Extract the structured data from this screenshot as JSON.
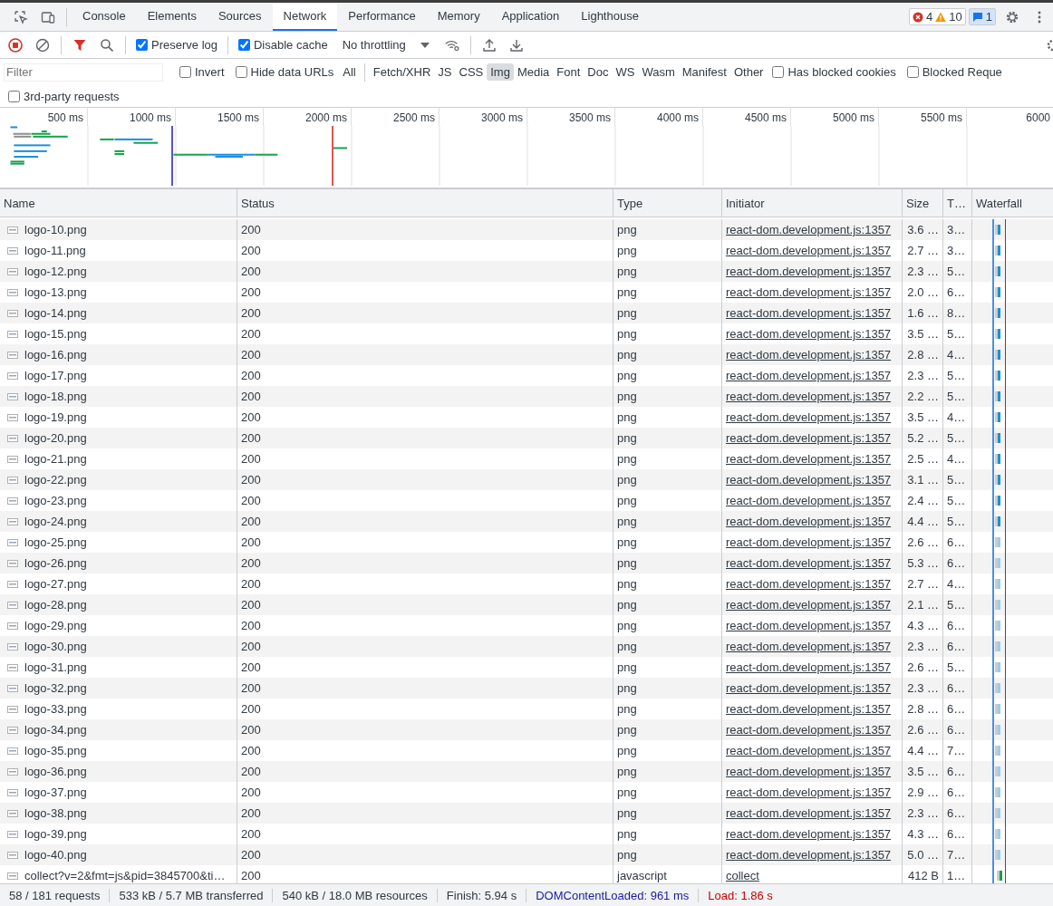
{
  "tabs": [
    {
      "label": "Console",
      "selected": false
    },
    {
      "label": "Elements",
      "selected": false
    },
    {
      "label": "Sources",
      "selected": false
    },
    {
      "label": "Network",
      "selected": true
    },
    {
      "label": "Performance",
      "selected": false
    },
    {
      "label": "Memory",
      "selected": false
    },
    {
      "label": "Application",
      "selected": false
    },
    {
      "label": "Lighthouse",
      "selected": false
    }
  ],
  "counters": {
    "errors": "4",
    "warnings": "10",
    "messages": "1"
  },
  "toolbar": {
    "preserve_log": {
      "label": "Preserve log",
      "checked": true
    },
    "disable_cache": {
      "label": "Disable cache",
      "checked": true
    },
    "throttling": "No throttling"
  },
  "filter": {
    "placeholder": "Filter",
    "options": [
      {
        "label": "Invert",
        "checked": false
      },
      {
        "label": "Hide data URLs",
        "checked": false
      }
    ],
    "types": [
      {
        "label": "All",
        "selected": false
      },
      {
        "label": "Fetch/XHR",
        "selected": false
      },
      {
        "label": "JS",
        "selected": false
      },
      {
        "label": "CSS",
        "selected": false
      },
      {
        "label": "Img",
        "selected": true
      },
      {
        "label": "Media",
        "selected": false
      },
      {
        "label": "Font",
        "selected": false
      },
      {
        "label": "Doc",
        "selected": false
      },
      {
        "label": "WS",
        "selected": false
      },
      {
        "label": "Wasm",
        "selected": false
      },
      {
        "label": "Manifest",
        "selected": false
      },
      {
        "label": "Other",
        "selected": false
      }
    ],
    "extra": [
      {
        "label": "Has blocked cookies",
        "checked": false
      },
      {
        "label": "Blocked Reque",
        "checked": false
      }
    ],
    "third_party": {
      "label": "3rd-party requests",
      "checked": false
    }
  },
  "overview": {
    "ticks": [
      "500 ms",
      "1000 ms",
      "1500 ms",
      "2000 ms",
      "2500 ms",
      "3000 ms",
      "3500 ms",
      "4000 ms",
      "4500 ms",
      "5000 ms",
      "5500 ms",
      "6000"
    ]
  },
  "table": {
    "columns": [
      "Name",
      "Status",
      "Type",
      "Initiator",
      "Size",
      "T…",
      "Waterfall"
    ],
    "rows": [
      {
        "name": "logo-10.png",
        "status": "200",
        "type": "png",
        "initiator": "react-dom.development.js:1357",
        "size": "3.6 …",
        "time": "3…"
      },
      {
        "name": "logo-11.png",
        "status": "200",
        "type": "png",
        "initiator": "react-dom.development.js:1357",
        "size": "2.7 …",
        "time": "3…"
      },
      {
        "name": "logo-12.png",
        "status": "200",
        "type": "png",
        "initiator": "react-dom.development.js:1357",
        "size": "2.3 …",
        "time": "5…"
      },
      {
        "name": "logo-13.png",
        "status": "200",
        "type": "png",
        "initiator": "react-dom.development.js:1357",
        "size": "2.0 …",
        "time": "6…"
      },
      {
        "name": "logo-14.png",
        "status": "200",
        "type": "png",
        "initiator": "react-dom.development.js:1357",
        "size": "1.6 …",
        "time": "8…"
      },
      {
        "name": "logo-15.png",
        "status": "200",
        "type": "png",
        "initiator": "react-dom.development.js:1357",
        "size": "3.5 …",
        "time": "5…"
      },
      {
        "name": "logo-16.png",
        "status": "200",
        "type": "png",
        "initiator": "react-dom.development.js:1357",
        "size": "2.8 …",
        "time": "4…"
      },
      {
        "name": "logo-17.png",
        "status": "200",
        "type": "png",
        "initiator": "react-dom.development.js:1357",
        "size": "2.3 …",
        "time": "5…"
      },
      {
        "name": "logo-18.png",
        "status": "200",
        "type": "png",
        "initiator": "react-dom.development.js:1357",
        "size": "2.2 …",
        "time": "5…"
      },
      {
        "name": "logo-19.png",
        "status": "200",
        "type": "png",
        "initiator": "react-dom.development.js:1357",
        "size": "3.5 …",
        "time": "4…"
      },
      {
        "name": "logo-20.png",
        "status": "200",
        "type": "png",
        "initiator": "react-dom.development.js:1357",
        "size": "5.2 …",
        "time": "5…"
      },
      {
        "name": "logo-21.png",
        "status": "200",
        "type": "png",
        "initiator": "react-dom.development.js:1357",
        "size": "2.5 …",
        "time": "4…"
      },
      {
        "name": "logo-22.png",
        "status": "200",
        "type": "png",
        "initiator": "react-dom.development.js:1357",
        "size": "3.1 …",
        "time": "5…"
      },
      {
        "name": "logo-23.png",
        "status": "200",
        "type": "png",
        "initiator": "react-dom.development.js:1357",
        "size": "2.4 …",
        "time": "5…"
      },
      {
        "name": "logo-24.png",
        "status": "200",
        "type": "png",
        "initiator": "react-dom.development.js:1357",
        "size": "4.4 …",
        "time": "5…"
      },
      {
        "name": "logo-25.png",
        "status": "200",
        "type": "png",
        "initiator": "react-dom.development.js:1357",
        "size": "2.6 …",
        "time": "6…"
      },
      {
        "name": "logo-26.png",
        "status": "200",
        "type": "png",
        "initiator": "react-dom.development.js:1357",
        "size": "5.3 …",
        "time": "6…"
      },
      {
        "name": "logo-27.png",
        "status": "200",
        "type": "png",
        "initiator": "react-dom.development.js:1357",
        "size": "2.7 …",
        "time": "4…"
      },
      {
        "name": "logo-28.png",
        "status": "200",
        "type": "png",
        "initiator": "react-dom.development.js:1357",
        "size": "2.1 …",
        "time": "5…"
      },
      {
        "name": "logo-29.png",
        "status": "200",
        "type": "png",
        "initiator": "react-dom.development.js:1357",
        "size": "4.3 …",
        "time": "6…"
      },
      {
        "name": "logo-30.png",
        "status": "200",
        "type": "png",
        "initiator": "react-dom.development.js:1357",
        "size": "2.3 …",
        "time": "6…"
      },
      {
        "name": "logo-31.png",
        "status": "200",
        "type": "png",
        "initiator": "react-dom.development.js:1357",
        "size": "2.6 …",
        "time": "5…"
      },
      {
        "name": "logo-32.png",
        "status": "200",
        "type": "png",
        "initiator": "react-dom.development.js:1357",
        "size": "2.3 …",
        "time": "6…"
      },
      {
        "name": "logo-33.png",
        "status": "200",
        "type": "png",
        "initiator": "react-dom.development.js:1357",
        "size": "2.8 …",
        "time": "6…"
      },
      {
        "name": "logo-34.png",
        "status": "200",
        "type": "png",
        "initiator": "react-dom.development.js:1357",
        "size": "2.6 …",
        "time": "6…"
      },
      {
        "name": "logo-35.png",
        "status": "200",
        "type": "png",
        "initiator": "react-dom.development.js:1357",
        "size": "4.4 …",
        "time": "7…"
      },
      {
        "name": "logo-36.png",
        "status": "200",
        "type": "png",
        "initiator": "react-dom.development.js:1357",
        "size": "3.5 …",
        "time": "6…"
      },
      {
        "name": "logo-37.png",
        "status": "200",
        "type": "png",
        "initiator": "react-dom.development.js:1357",
        "size": "2.9 …",
        "time": "6…"
      },
      {
        "name": "logo-38.png",
        "status": "200",
        "type": "png",
        "initiator": "react-dom.development.js:1357",
        "size": "2.3 …",
        "time": "6…"
      },
      {
        "name": "logo-39.png",
        "status": "200",
        "type": "png",
        "initiator": "react-dom.development.js:1357",
        "size": "4.3 …",
        "time": "6…"
      },
      {
        "name": "logo-40.png",
        "status": "200",
        "type": "png",
        "initiator": "react-dom.development.js:1357",
        "size": "5.0 …",
        "time": "7…"
      },
      {
        "name": "collect?v=2&fmt=js&pid=3845700&ti…",
        "status": "200",
        "type": "javascript",
        "initiator": "collect",
        "size": "412 B",
        "time": "1…"
      }
    ]
  },
  "status_bar": [
    {
      "text": "58 / 181 requests",
      "kind": "plain"
    },
    {
      "text": "533 kB / 5.7 MB transferred",
      "kind": "plain"
    },
    {
      "text": "540 kB / 18.0 MB resources",
      "kind": "plain"
    },
    {
      "text": "Finish: 5.94 s",
      "kind": "plain"
    },
    {
      "text": "DOMContentLoaded: 961 ms",
      "kind": "dom"
    },
    {
      "text": "Load: 1.86 s",
      "kind": "load"
    }
  ]
}
